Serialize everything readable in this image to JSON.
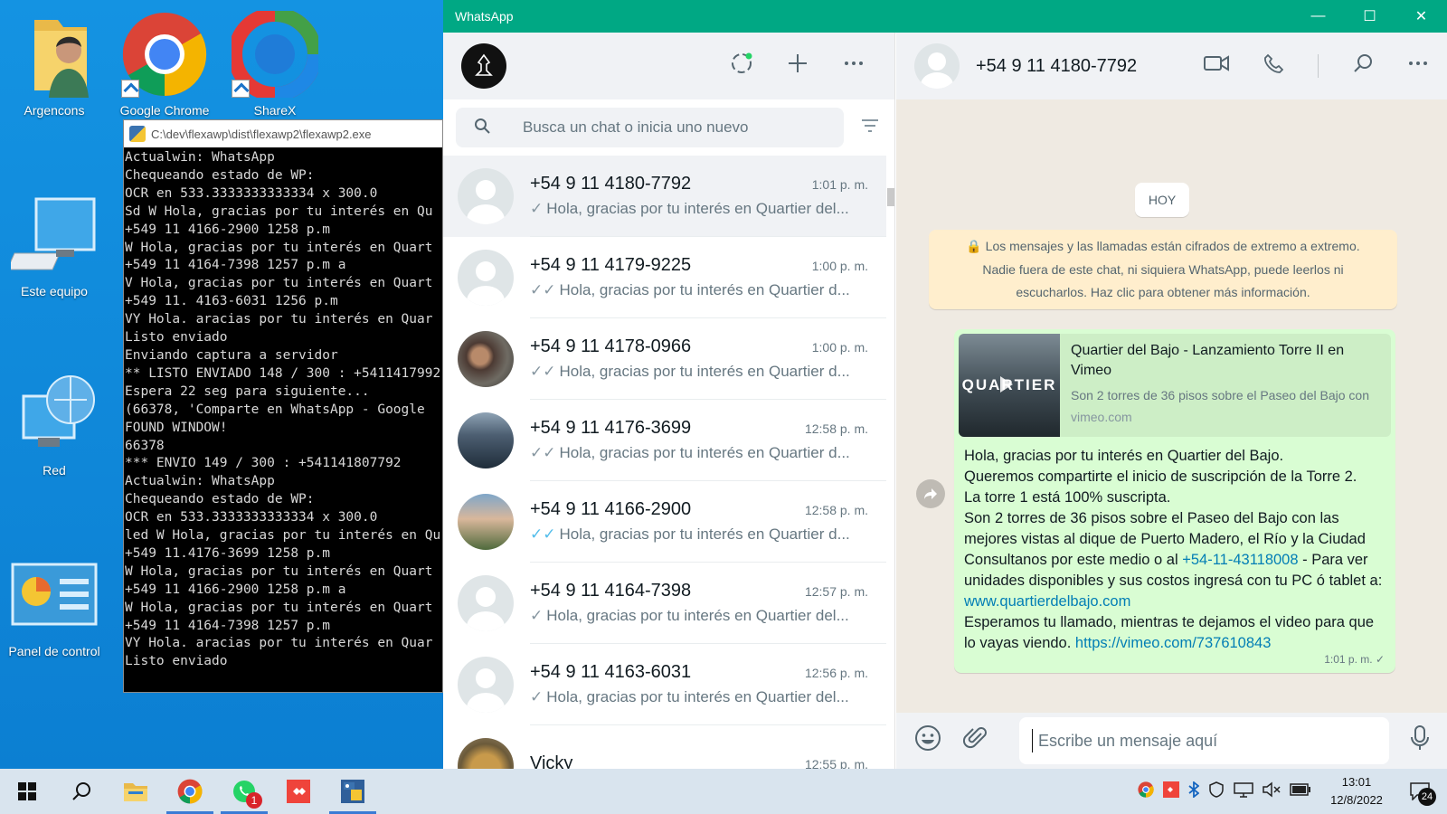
{
  "desktop": {
    "icons": [
      {
        "label": "Argencons"
      },
      {
        "label": "Google Chrome"
      },
      {
        "label": "ShareX"
      },
      {
        "label": "Este equipo"
      },
      {
        "label": "Red"
      },
      {
        "label": "Panel de control"
      }
    ]
  },
  "console": {
    "title": "C:\\dev\\flexawp\\dist\\flexawp2\\flexawp2.exe",
    "text": "Actualwin: WhatsApp\nChequeando estado de WP:\nOCR en 533.3333333333334 x 300.0\nSd W Hola, gracias por tu interés en Qu\n+549 11 4166-2900 1258 p.m\nW Hola, gracias por tu interés en Quart\n+549 11 4164-7398 1257 p.m a\nV Hola, gracias por tu interés en Quart\n+549 11. 4163-6031 1256 p.m\nVY Hola. aracias por tu interés en Quar\nListo enviado\nEnviando captura a servidor\n** LISTO ENVIADO 148 / 300 : +5411417992\nEspera 22 seg para siguiente...\n(66378, 'Comparte en WhatsApp - Google\nFOUND WINDOW!\n66378\n*** ENVIO 149 / 300 : +541141807792\nActualwin: WhatsApp\nChequeando estado de WP:\nOCR en 533.3333333333334 x 300.0\nled W Hola, gracias por tu interés en Qu\n+549 11.4176-3699 1258 p.m\nW Hola, gracias por tu interés en Quart\n+549 11 4166-2900 1258 p.m a\nW Hola, gracias por tu interés en Quart\n+549 11 4164-7398 1257 p.m\nVY Hola. aracias por tu interés en Quar\nListo enviado"
  },
  "whatsapp": {
    "window_title": "WhatsApp",
    "window_controls": {
      "minimize": "—",
      "maximize": "☐",
      "close": "✕"
    },
    "search_placeholder": "Busca un chat o inicia uno nuevo",
    "chats": [
      {
        "name": "+54 9 11 4180-7792",
        "time": "1:01 p. m.",
        "tick": "✓",
        "read": false,
        "preview": "Hola, gracias por tu interés en Quartier del...",
        "avatar": "default",
        "selected": true
      },
      {
        "name": "+54 9 11 4179-9225",
        "time": "1:00 p. m.",
        "tick": "✓✓",
        "read": false,
        "preview": "Hola, gracias por tu interés en Quartier d...",
        "avatar": "default",
        "selected": false
      },
      {
        "name": "+54 9 11 4178-0966",
        "time": "1:00 p. m.",
        "tick": "✓✓",
        "read": false,
        "preview": "Hola, gracias por tu interés en Quartier d...",
        "avatar": "photo",
        "selected": false
      },
      {
        "name": "+54 9 11 4176-3699",
        "time": "12:58 p. m.",
        "tick": "✓✓",
        "read": false,
        "preview": "Hola, gracias por tu interés en Quartier d...",
        "avatar": "photo",
        "selected": false
      },
      {
        "name": "+54 9 11 4166-2900",
        "time": "12:58 p. m.",
        "tick": "✓✓",
        "read": true,
        "preview": "Hola, gracias por tu interés en Quartier d...",
        "avatar": "photo",
        "selected": false
      },
      {
        "name": "+54 9 11 4164-7398",
        "time": "12:57 p. m.",
        "tick": "✓",
        "read": false,
        "preview": "Hola, gracias por tu interés en Quartier del...",
        "avatar": "default",
        "selected": false
      },
      {
        "name": "+54 9 11 4163-6031",
        "time": "12:56 p. m.",
        "tick": "✓",
        "read": false,
        "preview": "Hola, gracias por tu interés en Quartier del...",
        "avatar": "default",
        "selected": false
      },
      {
        "name": "Vicky",
        "time": "12:55 p. m.",
        "tick": "",
        "read": false,
        "preview": "",
        "avatar": "photo",
        "selected": false
      }
    ],
    "conversation": {
      "contact": "+54 9 11 4180-7792",
      "day_chip": "HOY",
      "encryption_notice": "Los mensajes y las llamadas están cifrados de extremo a extremo. Nadie fuera de este chat, ni siquiera WhatsApp, puede leerlos ni escucharlos. Haz clic para obtener más información.",
      "link_preview": {
        "thumb_text": "QUARTIER",
        "title": "Quartier del Bajo - Lanzamiento Torre II en Vimeo",
        "description": "Son 2 torres de 36 pisos sobre el Paseo del Bajo con",
        "domain": "vimeo.com"
      },
      "message": {
        "p1": "Hola, gracias por tu interés en Quartier del Bajo.",
        "p2": "Queremos compartirte el inicio de suscripción de la Torre 2.",
        "p3": "La torre 1 está 100% suscripta.",
        "p4": "Son 2 torres de 36 pisos sobre el Paseo del Bajo con las mejores vistas al dique de Puerto Madero, el Río y la Ciudad",
        "p5a": "Consultanos por este medio o al ",
        "phone": "+54-11-43118008",
        "p5b": " - Para ver unidades disponibles y sus costos ingresá con tu PC ó tablet a: ",
        "site": "www.quartierdelbajo.com",
        "p6": "Esperamos tu llamado, mientras te dejamos el video para que lo vayas viendo. ",
        "video": "https://vimeo.com/737610843",
        "time": "1:01 p. m.",
        "tick": "✓"
      },
      "composer_placeholder": "Escribe un mensaje aquí"
    }
  },
  "taskbar": {
    "whatsapp_badge": "1",
    "clock_time": "13:01",
    "clock_date": "12/8/2022",
    "notifications_count": "24"
  },
  "colors": {
    "whatsapp_green": "#00a884",
    "outgoing_bubble": "#d9fdd3",
    "link": "#027eb5",
    "read_tick": "#53bdeb"
  }
}
